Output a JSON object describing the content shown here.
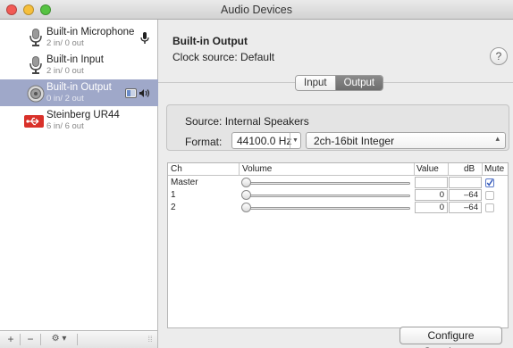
{
  "window": {
    "title": "Audio Devices"
  },
  "devices": [
    {
      "name": "Built-in Microphone",
      "io": "2 in/ 0 out",
      "icon": "microphone-icon",
      "badge": "microphone-badge-icon"
    },
    {
      "name": "Built-in Input",
      "io": "2 in/ 0 out",
      "icon": "line-input-icon"
    },
    {
      "name": "Built-in Output",
      "io": "0 in/ 2 out",
      "icon": "speaker-icon",
      "badge": "finder-speaker-badge-icon",
      "selected": true
    },
    {
      "name": "Steinberg UR44",
      "io": "6 in/ 6 out",
      "icon": "usb-icon"
    }
  ],
  "sidebar_bottom": {
    "add": "+",
    "remove": "−",
    "gear": "⚙ ▾",
    "resize": "⁞⁞"
  },
  "main": {
    "title": "Built-in Output",
    "clock_label": "Clock source:",
    "clock_value": "Default",
    "help": "?",
    "tabs": [
      {
        "label": "Input"
      },
      {
        "label": "Output",
        "active": true
      }
    ],
    "source_label": "Source:",
    "source_value": "Internal Speakers",
    "format_label": "Format:",
    "sample_rate": "44100.0 Hz",
    "bit_format": "2ch-16bit Integer",
    "table": {
      "headers": {
        "ch": "Ch",
        "volume": "Volume",
        "value": "Value",
        "db": "dB",
        "mute": "Mute"
      },
      "rows": [
        {
          "ch": "Master",
          "volume": 0,
          "value": "",
          "db": "",
          "mute": true
        },
        {
          "ch": "1",
          "volume": 0,
          "value": "0",
          "db": "–64",
          "mute": false
        },
        {
          "ch": "2",
          "volume": 0,
          "value": "0",
          "db": "–64",
          "mute": false
        }
      ]
    },
    "configure_button": "Configure Speakers..."
  },
  "colors": {
    "selection": "#9fa8c9",
    "close": "#f25a55",
    "minimize": "#f6bf3b",
    "zoom": "#56c342",
    "usb_red": "#d9312a"
  }
}
